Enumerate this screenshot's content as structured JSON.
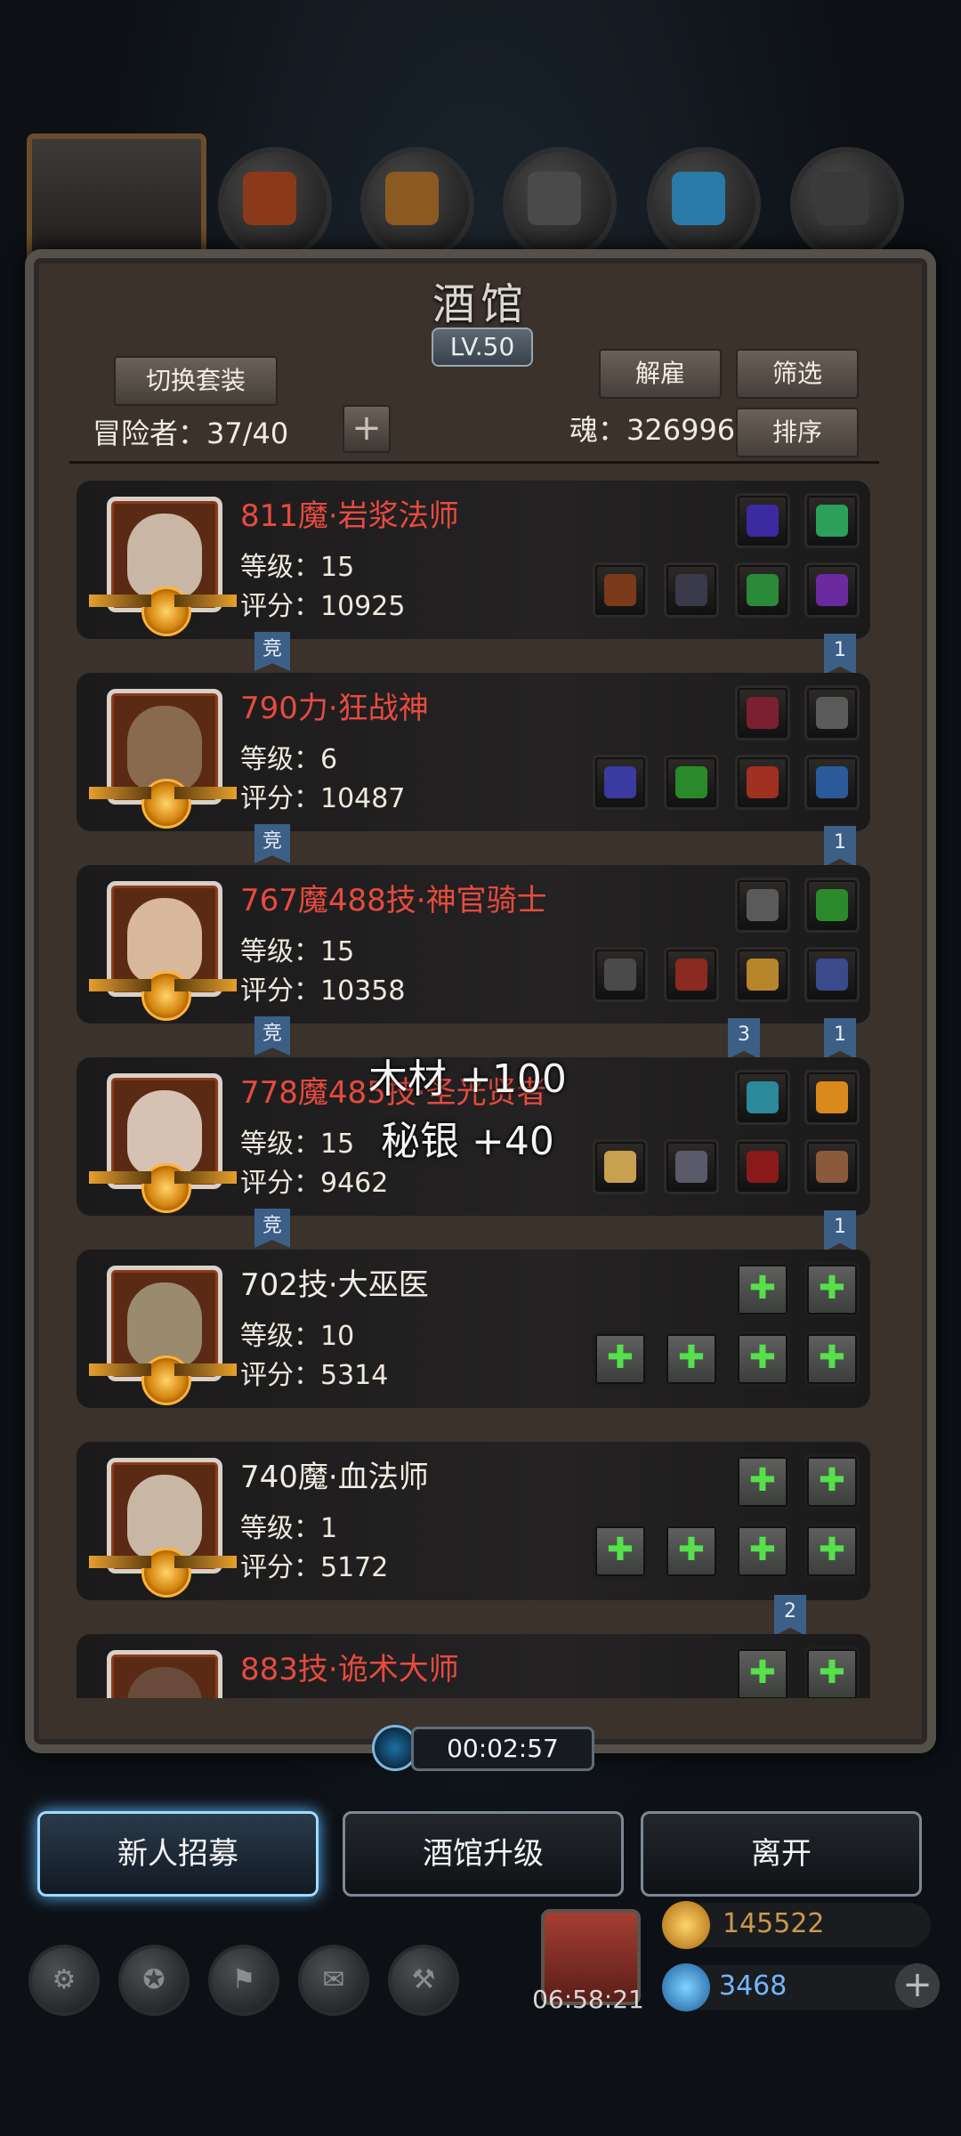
{
  "colors": {
    "accent_red": "#e74b3e",
    "ribbon_blue": "#3c5f88",
    "active_glow": "#5fb8ff",
    "empty_slot_plus": "#55e04c"
  },
  "header": {
    "title": "酒馆",
    "level": "LV.50"
  },
  "toolbar": {
    "switch_outfit": "切换套装",
    "dismiss": "解雇",
    "filter": "筛选",
    "sort": "排序",
    "add_icon": "+"
  },
  "summary": {
    "adventurers_label": "冒险者：37/40",
    "soul_label": "魂：326996"
  },
  "heroes": [
    {
      "name": "811魔·岩浆法师",
      "level": "等级：15",
      "score": "评分：10925",
      "red": true,
      "jing": "竞",
      "ribbons": [
        "1"
      ],
      "face": "#c9b7a6",
      "gear": [
        "#3b2aa0",
        "#2aa05a",
        "#7a3a1a",
        "#3a3a4a",
        "#2a8a3a",
        "#6a2aa0"
      ],
      "empty": false
    },
    {
      "name": "790力·狂战神",
      "level": "等级：6",
      "score": "评分：10487",
      "red": true,
      "jing": "竞",
      "ribbons": [
        "1"
      ],
      "face": "#8a6a4e",
      "gear": [
        "#7a2030",
        "#5a5a5a",
        "#3a3aa0",
        "#2a8a2a",
        "#a03020",
        "#2a5a9a"
      ],
      "empty": false
    },
    {
      "name": "767魔488技·神官骑士",
      "level": "等级：15",
      "score": "评分：10358",
      "red": true,
      "jing": "竞",
      "ribbons": [
        "3",
        "1"
      ],
      "face": "#d9b79a",
      "gear": [
        "#5a5a5a",
        "#2a8a2a",
        "#4a4a4a",
        "#8a2a20",
        "#b8862a",
        "#3a4a8a"
      ],
      "empty": false
    },
    {
      "name": "778魔485技·圣光贤者",
      "level": "等级：15",
      "score": "评分：9462",
      "red": true,
      "jing": "竞",
      "ribbons": [
        "1"
      ],
      "face": "#d6c2b2",
      "gear": [
        "#2a8a9a",
        "#d98a1a",
        "#c8a050",
        "#5a5a6a",
        "#8a1a1a",
        "#8a5a3a"
      ],
      "empty": false
    },
    {
      "name": "702技·大巫医",
      "level": "等级：10",
      "score": "评分：5314",
      "red": false,
      "ribbons": [],
      "face": "#9a8a6e",
      "empty": true
    },
    {
      "name": "740魔·血法师",
      "level": "等级：1",
      "score": "评分：5172",
      "red": false,
      "ribbons": [
        "2"
      ],
      "face": "#c9b7a6",
      "empty": true
    },
    {
      "name": "883技·诡术大师",
      "level": "",
      "score": "",
      "red": true,
      "ribbons": [],
      "face": "#6a4a3a",
      "empty": true
    }
  ],
  "float_rewards": [
    "木材 +100",
    "秘银 +40"
  ],
  "timer": "00:02:57",
  "actions": {
    "recruit": "新人招募",
    "upgrade": "酒馆升级",
    "leave": "离开"
  },
  "footer": {
    "gift_time": "06:58:21",
    "gold": "145522",
    "gems": "3468",
    "plus": "+"
  }
}
